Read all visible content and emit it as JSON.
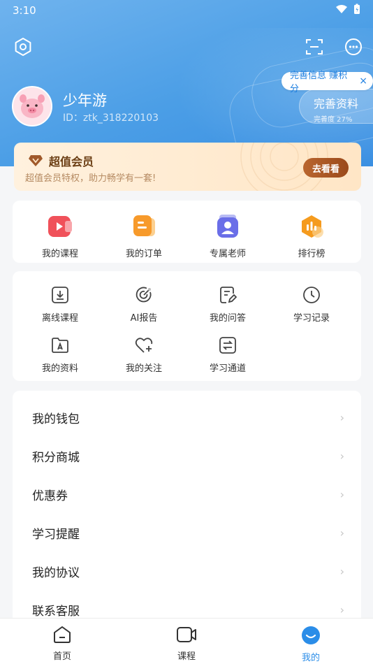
{
  "status_bar": {
    "time": "3:10"
  },
  "profile": {
    "username": "少年游",
    "user_id": "ID：ztk_318220103",
    "complete_bubble": "完善信息 赚积分",
    "complete_bubble_close": "×",
    "complete_title": "完善资料",
    "complete_sub": "完善度 27%"
  },
  "vip": {
    "title": "超值会员",
    "desc": "超值会员特权，助力畅学有一套!",
    "button": "去看看"
  },
  "quick_actions": [
    {
      "label": "我的课程",
      "icon": "video-play-icon",
      "color": "#f0515a"
    },
    {
      "label": "我的订单",
      "icon": "order-list-icon",
      "color": "#f79a2b"
    },
    {
      "label": "专属老师",
      "icon": "teacher-icon",
      "color": "#6a6ee8"
    },
    {
      "label": "排行榜",
      "icon": "ranking-chart-icon",
      "color": "#f59b1e"
    }
  ],
  "tools": [
    {
      "label": "离线课程",
      "icon": "download-box-icon"
    },
    {
      "label": "AI报告",
      "icon": "target-report-icon"
    },
    {
      "label": "我的问答",
      "icon": "qa-edit-icon"
    },
    {
      "label": "学习记录",
      "icon": "clock-icon"
    },
    {
      "label": "我的资料",
      "icon": "folder-pdf-icon"
    },
    {
      "label": "我的关注",
      "icon": "heart-plus-icon"
    },
    {
      "label": "学习通道",
      "icon": "exchange-icon"
    }
  ],
  "menu": [
    {
      "label": "我的钱包"
    },
    {
      "label": "积分商城"
    },
    {
      "label": "优惠券"
    },
    {
      "label": "学习提醒"
    },
    {
      "label": "我的协议"
    },
    {
      "label": "联系客服"
    }
  ],
  "chevron": "›",
  "tabs": [
    {
      "label": "首页",
      "icon": "home-icon"
    },
    {
      "label": "课程",
      "icon": "video-camera-icon"
    },
    {
      "label": "我的",
      "icon": "profile-smile-icon",
      "active": true
    }
  ],
  "colors": {
    "accent": "#2b8de8",
    "hero": "#4b9ee6",
    "vip_button": "#a9571f"
  }
}
